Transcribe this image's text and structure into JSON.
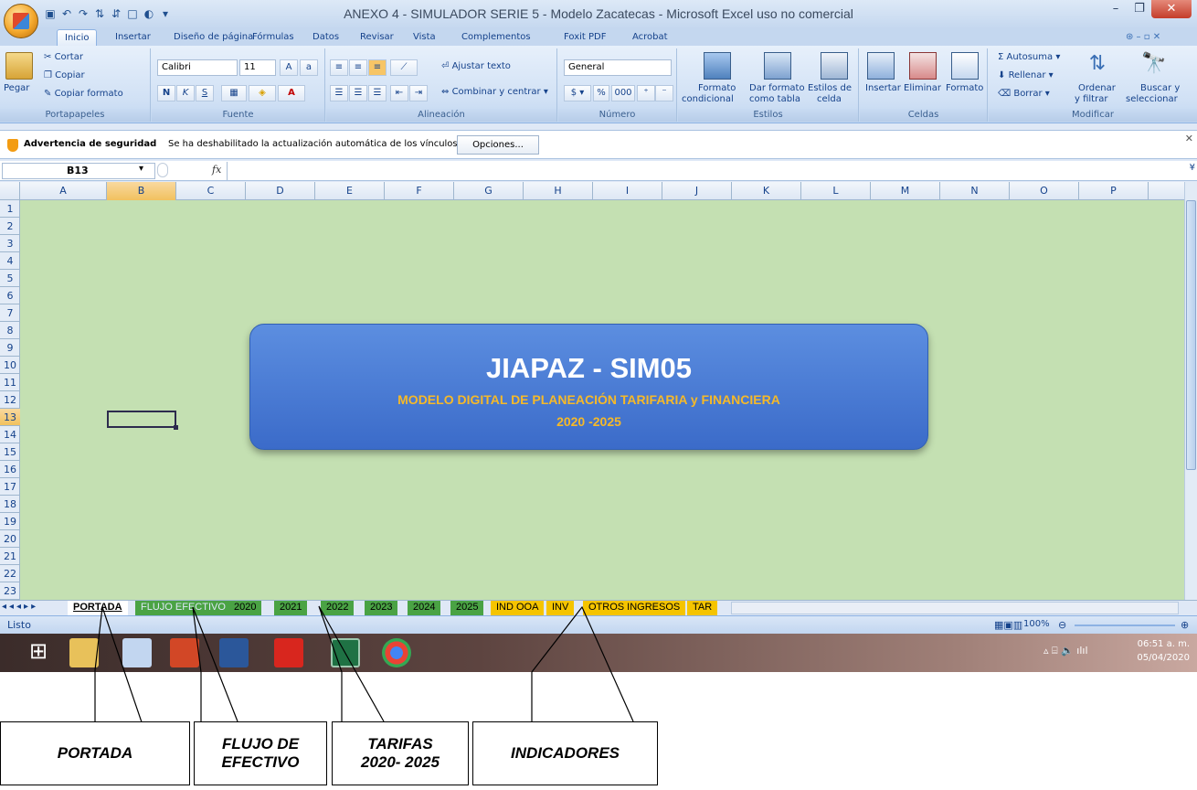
{
  "window": {
    "title": "ANEXO 4 - SIMULADOR SERIE 5 - Modelo Zacatecas - Microsoft Excel uso no comercial"
  },
  "ribbon_tabs": [
    "Inicio",
    "Insertar",
    "Diseño de página",
    "Fórmulas",
    "Datos",
    "Revisar",
    "Vista",
    "Complementos",
    "Foxit PDF",
    "Acrobat"
  ],
  "ribbon": {
    "clipboard": {
      "paste": "Pegar",
      "cut": "Cortar",
      "copy": "Copiar",
      "format_painter": "Copiar formato",
      "label": "Portapapeles"
    },
    "font": {
      "name": "Calibri",
      "size": "11",
      "label": "Fuente"
    },
    "alignment": {
      "wrap": "Ajustar texto",
      "merge": "Combinar y centrar",
      "label": "Alineación"
    },
    "number": {
      "format": "General",
      "label": "Número"
    },
    "styles": {
      "cond_format_1": "Formato",
      "cond_format_2": "condicional",
      "table_1": "Dar formato",
      "table_2": "como tabla",
      "cell_styles_1": "Estilos de",
      "cell_styles_2": "celda",
      "label": "Estilos"
    },
    "cells": {
      "insert": "Insertar",
      "delete": "Eliminar",
      "format": "Formato",
      "label": "Celdas"
    },
    "editing": {
      "autosum": "Autosuma",
      "fill": "Rellenar",
      "clear": "Borrar",
      "sort_1": "Ordenar",
      "sort_2": "y filtrar",
      "find_1": "Buscar y",
      "find_2": "seleccionar",
      "label": "Modificar"
    }
  },
  "security_bar": {
    "title": "Advertencia de seguridad",
    "message": "Se ha deshabilitado la actualización automática de los vínculos",
    "button": "Opciones..."
  },
  "formula_bar": {
    "name_box": "B13",
    "fx": "fx",
    "value": ""
  },
  "columns": [
    "A",
    "B",
    "C",
    "D",
    "E",
    "F",
    "G",
    "H",
    "I",
    "J",
    "K",
    "L",
    "M",
    "N",
    "O",
    "P"
  ],
  "rows": [
    "1",
    "2",
    "3",
    "4",
    "5",
    "6",
    "7",
    "8",
    "9",
    "10",
    "11",
    "12",
    "13",
    "14",
    "15",
    "16",
    "17",
    "18",
    "19",
    "20",
    "21",
    "22",
    "23"
  ],
  "selected_cell": {
    "column": "B",
    "row": "13"
  },
  "banner": {
    "title": "JIAPAZ - SIM05",
    "subtitle": "MODELO DIGITAL DE PLANEACIÓN TARIFARIA y FINANCIERA",
    "years": "2020 -2025"
  },
  "sheet_tabs": [
    {
      "label": "PORTADA",
      "color": "#ffffff",
      "active": true
    },
    {
      "label": "FLUJO EFECTIVO",
      "color": "#4aa344"
    },
    {
      "label": "2020",
      "color": "#4aa344"
    },
    {
      "label": "2021",
      "color": "#4aa344"
    },
    {
      "label": "2022",
      "color": "#4aa344"
    },
    {
      "label": "2023",
      "color": "#4aa344"
    },
    {
      "label": "2024",
      "color": "#4aa344"
    },
    {
      "label": "2025",
      "color": "#4aa344"
    },
    {
      "label": "IND OOA",
      "color": "#f5c400"
    },
    {
      "label": "INV",
      "color": "#f5c400"
    },
    {
      "label": "OTROS INGRESOS",
      "color": "#f5c400"
    },
    {
      "label": "TAR",
      "color": "#f5c400"
    }
  ],
  "status": {
    "text": "Listo",
    "zoom": "100%"
  },
  "taskbar": {
    "time": "06:51 a. m.",
    "date": "05/04/2020"
  },
  "annotations": [
    {
      "label": "PORTADA"
    },
    {
      "line1": "FLUJO DE",
      "line2": "EFECTIVO"
    },
    {
      "line1": "TARIFAS",
      "line2": "2020- 2025"
    },
    {
      "label": "INDICADORES"
    }
  ],
  "colors": {
    "sheet_bg": "#c4e0b2",
    "banner": "#4a7bd6",
    "banner_text": "#f6b928",
    "tab_green": "#4aa344",
    "tab_yellow": "#f5c400"
  }
}
